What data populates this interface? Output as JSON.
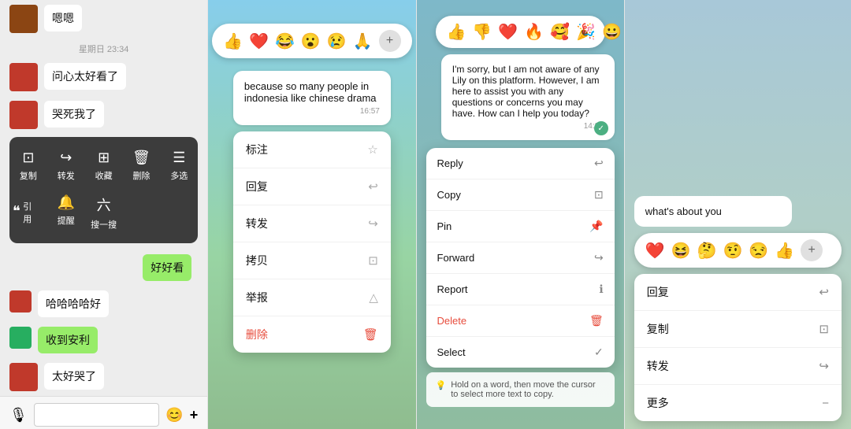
{
  "panel1": {
    "messages": [
      {
        "id": "msg1",
        "text": "嗯嗯",
        "side": "left",
        "hasAvatar": false
      },
      {
        "id": "ts1",
        "text": "星期日 23:34",
        "type": "timestamp"
      },
      {
        "id": "msg2",
        "text": "问心太好看了",
        "side": "left",
        "hasAvatar": true
      },
      {
        "id": "msg3",
        "text": "哭死我了",
        "side": "left",
        "hasAvatar": true
      }
    ],
    "contextMenu": {
      "row1": [
        {
          "label": "复制",
          "icon": "⊡"
        },
        {
          "label": "转发",
          "icon": "↪"
        },
        {
          "label": "收藏",
          "icon": "⊞"
        },
        {
          "label": "删除",
          "icon": "🗑"
        },
        {
          "label": "多选",
          "icon": "☰"
        }
      ],
      "row2": [
        {
          "label": "引用",
          "icon": "❝"
        },
        {
          "label": "提醒",
          "icon": "🔔"
        },
        {
          "label": "搜一搜",
          "icon": "六"
        }
      ]
    },
    "bottomMessages": [
      {
        "text": "好好看",
        "side": "right",
        "green": true
      },
      {
        "text": "哈哈哈哈好",
        "side": "left"
      },
      {
        "text": "收到安利",
        "side": "left",
        "green": true
      },
      {
        "text": "太好哭了",
        "side": "left",
        "hasAvatar": true
      }
    ]
  },
  "panel2": {
    "emojis": [
      "👍",
      "❤️",
      "😂",
      "😮",
      "😢",
      "🙏"
    ],
    "plusLabel": "+",
    "message": {
      "text": "because so many people in indonesia like chinese drama",
      "time": "16:57"
    },
    "contextMenu": [
      {
        "label": "标注",
        "icon": "☆"
      },
      {
        "label": "回复",
        "icon": "↩"
      },
      {
        "label": "转发",
        "icon": "↪"
      },
      {
        "label": "拷贝",
        "icon": "⊡"
      },
      {
        "label": "举报",
        "icon": "△"
      },
      {
        "label": "删除",
        "icon": "🗑",
        "red": true
      }
    ]
  },
  "panel3": {
    "emojis": [
      "👍",
      "👎",
      "❤️",
      "🔥",
      "🥰",
      "🎉",
      "😀"
    ],
    "message": {
      "text": "I'm sorry, but I am not aware of any Lily on this platform. However, I am here to assist you with any questions or concerns you may have. How can I help you today?",
      "time": "14:31"
    },
    "contextMenu": [
      {
        "label": "Reply",
        "icon": "↩"
      },
      {
        "label": "Copy",
        "icon": "⊡"
      },
      {
        "label": "Pin",
        "icon": "📌"
      },
      {
        "label": "Forward",
        "icon": "↪"
      },
      {
        "label": "Report",
        "icon": "ℹ"
      },
      {
        "label": "Delete",
        "icon": "🗑",
        "red": true
      },
      {
        "label": "Select",
        "icon": "✓"
      }
    ],
    "hint": "Hold on a word, then move the cursor to select more text to copy."
  },
  "panel4": {
    "emojis": [
      "❤️",
      "😆",
      "🤔",
      "🤨",
      "😒",
      "👍"
    ],
    "plusLabel": "+",
    "message": {
      "text": "what's about you"
    },
    "contextMenu": [
      {
        "label": "回复",
        "icon": "↩"
      },
      {
        "label": "复制",
        "icon": "⊡"
      },
      {
        "label": "转发",
        "icon": "↪"
      },
      {
        "label": "更多",
        "icon": "−"
      }
    ]
  }
}
